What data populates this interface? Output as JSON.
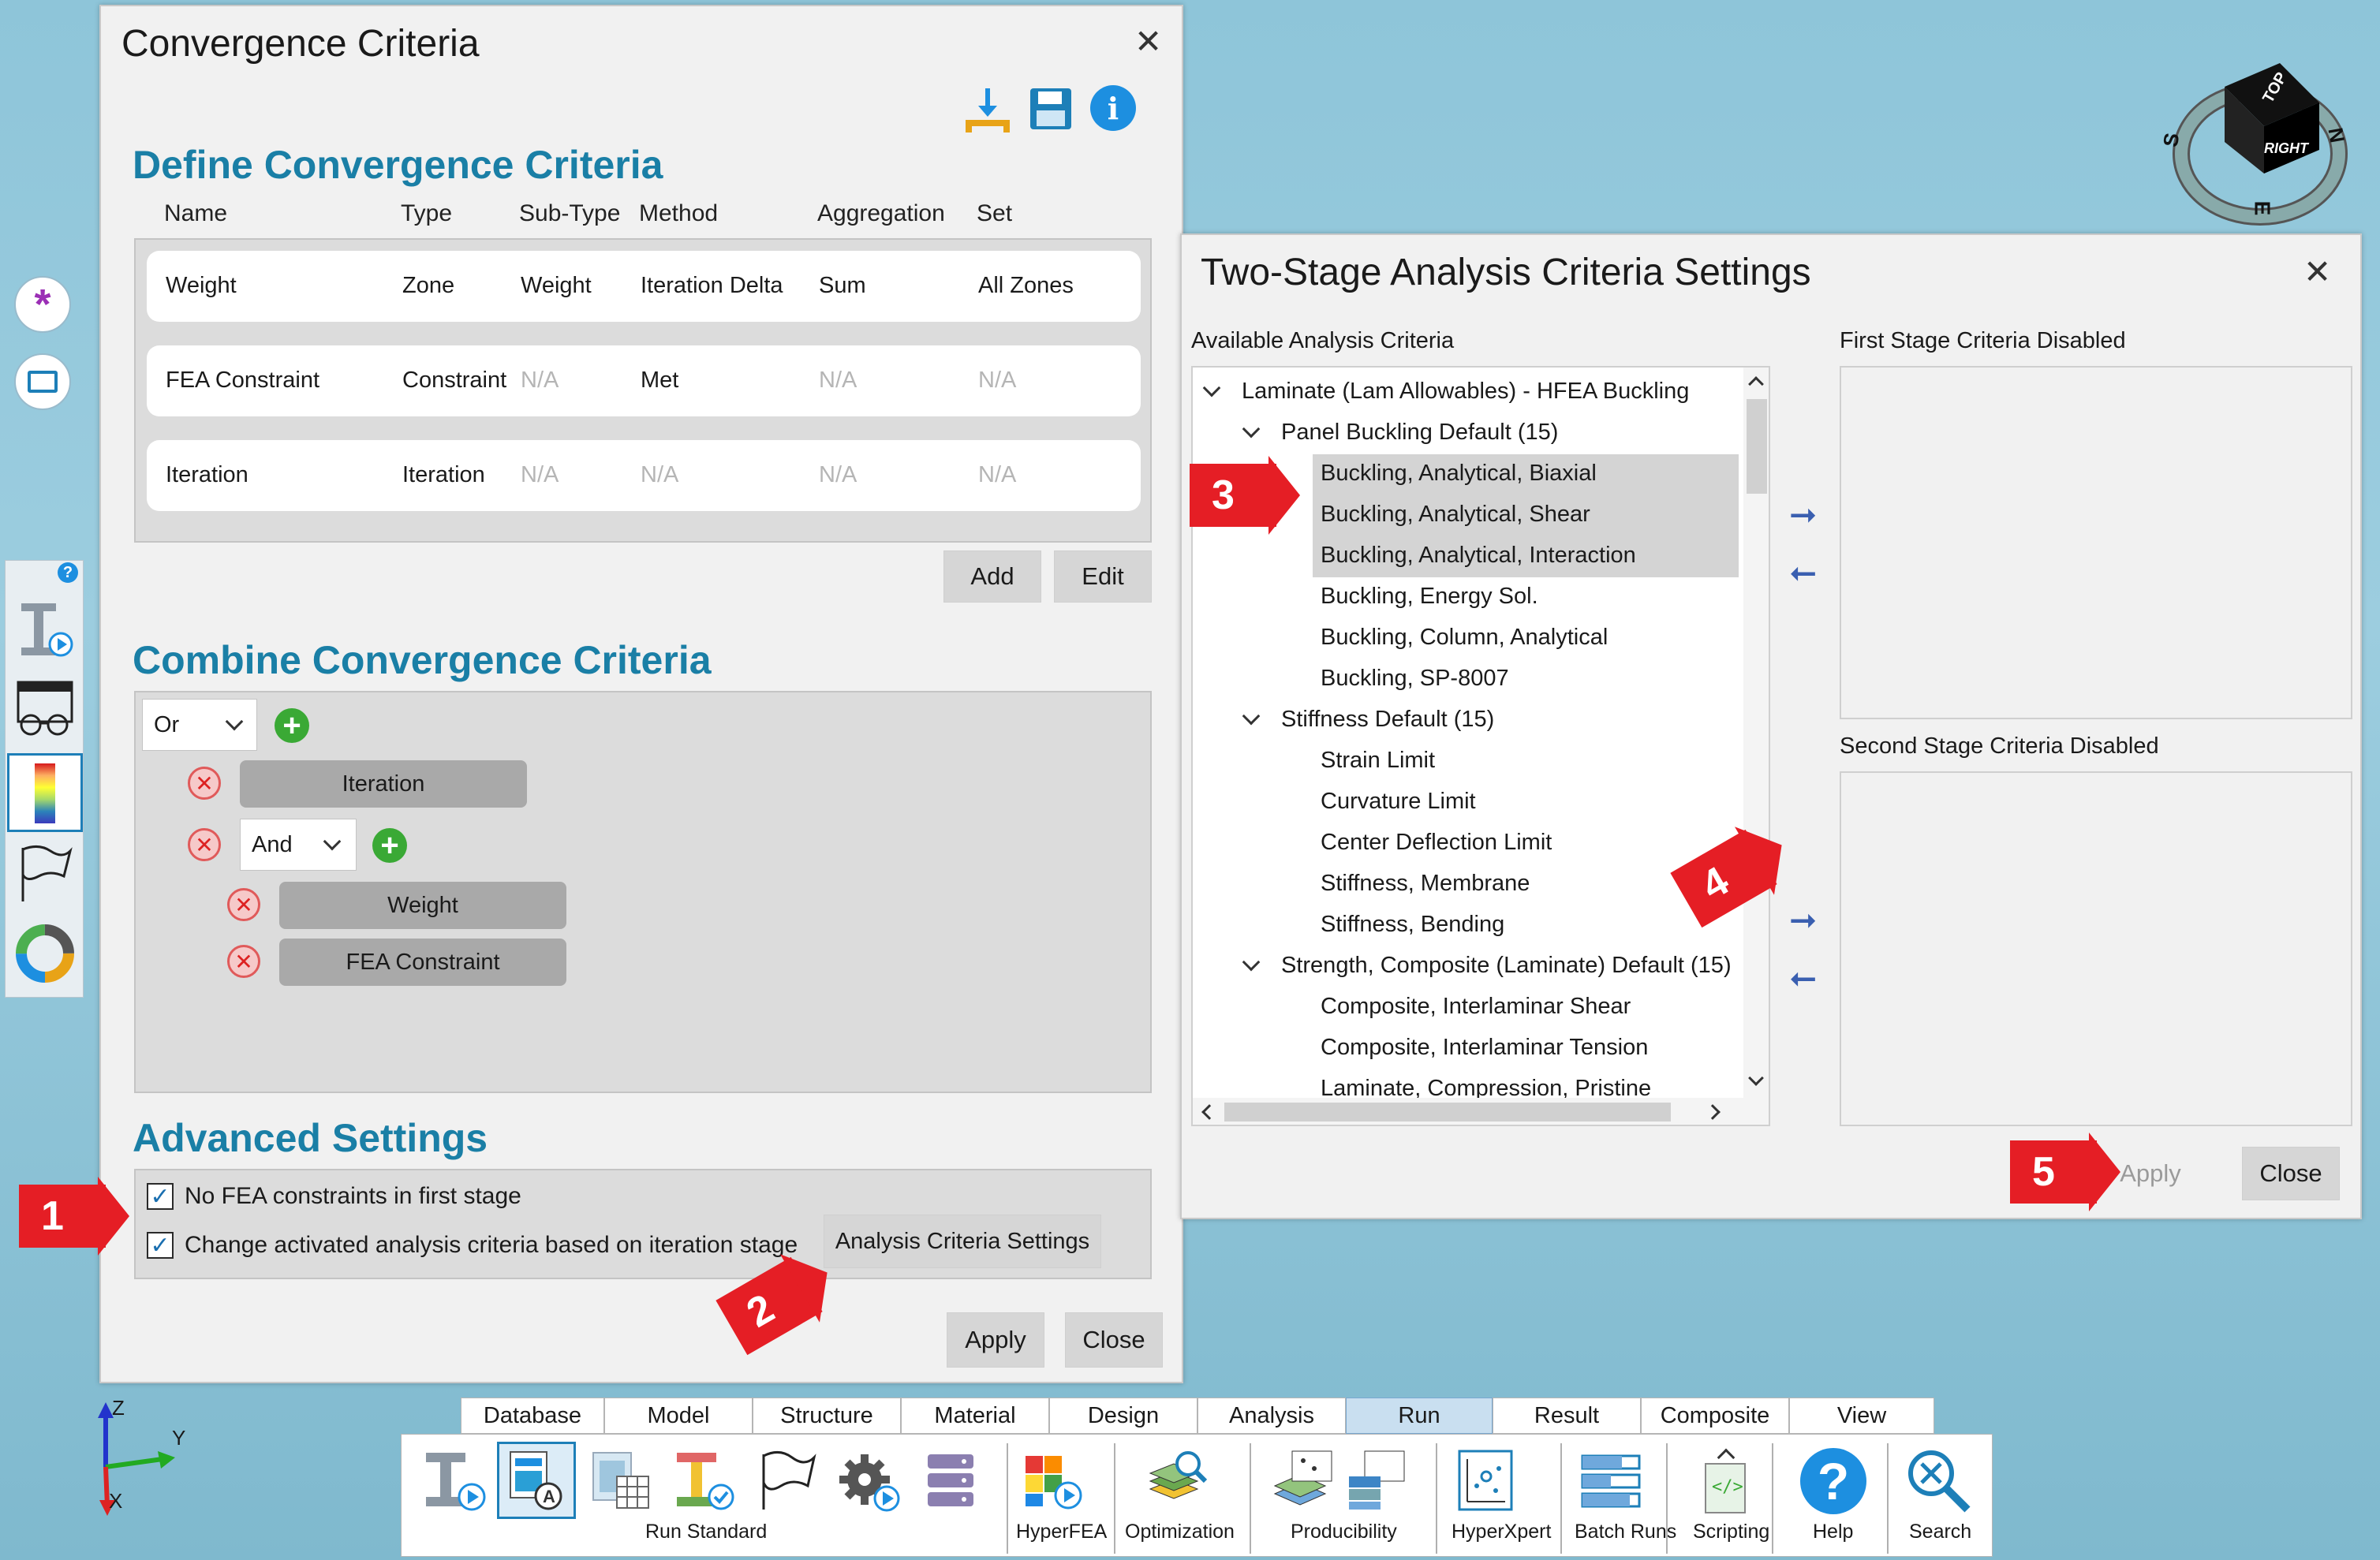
{
  "left_toolbar": {
    "help_badge": "?"
  },
  "conv_dialog": {
    "title": "Convergence Criteria",
    "define": {
      "heading": "Define Convergence Criteria",
      "columns": [
        "Name",
        "Type",
        "Sub-Type",
        "Method",
        "Aggregation",
        "Set"
      ],
      "rows": [
        [
          "Weight",
          "Zone",
          "Weight",
          "Iteration Delta",
          "Sum",
          "All Zones"
        ],
        [
          "FEA Constraint",
          "Constraint",
          "N/A",
          "Met",
          "N/A",
          "N/A"
        ],
        [
          "Iteration",
          "Iteration",
          "N/A",
          "N/A",
          "N/A",
          "N/A"
        ]
      ],
      "add": "Add",
      "edit": "Edit"
    },
    "combine": {
      "heading": "Combine Convergence Criteria",
      "root_op": "Or",
      "iteration": "Iteration",
      "sub_op": "And",
      "weight": "Weight",
      "fea": "FEA Constraint"
    },
    "advanced": {
      "heading": "Advanced Settings",
      "opt1": "No FEA constraints in first stage",
      "opt2": "Change activated analysis criteria based on iteration stage",
      "settings_btn": "Analysis Criteria Settings"
    },
    "apply": "Apply",
    "close": "Close"
  },
  "two_stage": {
    "title": "Two-Stage Analysis Criteria Settings",
    "available_label": "Available Analysis Criteria",
    "first_label": "First Stage Criteria Disabled",
    "second_label": "Second Stage Criteria Disabled",
    "tree": [
      {
        "level": 0,
        "text": "Laminate (Lam Allowables) - HFEA Buckling",
        "expanded": true
      },
      {
        "level": 1,
        "text": "Panel Buckling Default (15)",
        "expanded": true
      },
      {
        "level": 2,
        "text": "Buckling, Analytical, Biaxial",
        "selected": true
      },
      {
        "level": 2,
        "text": "Buckling, Analytical, Shear",
        "selected": true
      },
      {
        "level": 2,
        "text": "Buckling, Analytical, Interaction",
        "selected": true
      },
      {
        "level": 2,
        "text": "Buckling, Energy Sol."
      },
      {
        "level": 2,
        "text": "Buckling, Column, Analytical"
      },
      {
        "level": 2,
        "text": "Buckling, SP-8007"
      },
      {
        "level": 1,
        "text": "Stiffness Default (15)",
        "expanded": true
      },
      {
        "level": 2,
        "text": "Strain Limit"
      },
      {
        "level": 2,
        "text": "Curvature Limit"
      },
      {
        "level": 2,
        "text": "Center Deflection Limit"
      },
      {
        "level": 2,
        "text": "Stiffness, Membrane"
      },
      {
        "level": 2,
        "text": "Stiffness, Bending"
      },
      {
        "level": 1,
        "text": "Strength, Composite (Laminate) Default (15)",
        "expanded": true
      },
      {
        "level": 2,
        "text": "Composite, Interlaminar Shear"
      },
      {
        "level": 2,
        "text": "Composite, Interlaminar Tension"
      },
      {
        "level": 2,
        "text": "Laminate, Compression, Pristine"
      }
    ],
    "apply": "Apply",
    "close": "Close"
  },
  "annotations": [
    "1",
    "2",
    "3",
    "4",
    "5"
  ],
  "view_cube": {
    "top": "TOP",
    "right": "RIGHT",
    "s": "S",
    "n": "N",
    "e": "E"
  },
  "axes": {
    "z": "Z",
    "y": "Y",
    "x": "X"
  },
  "ribbon": {
    "tabs": [
      "Database",
      "Model",
      "Structure",
      "Material",
      "Design",
      "Analysis",
      "Run",
      "Result",
      "Composite",
      "View"
    ],
    "active_tab": "Run",
    "groups": [
      "Run Standard",
      "HyperFEA",
      "Optimization",
      "Producibility",
      "HyperXpert",
      "Batch Runs",
      "Scripting",
      "Help",
      "Search"
    ]
  },
  "colors": {
    "accent": "#1a7fa6",
    "annotation_red": "#e51e25",
    "tree_selection": "#d4d4d4"
  }
}
